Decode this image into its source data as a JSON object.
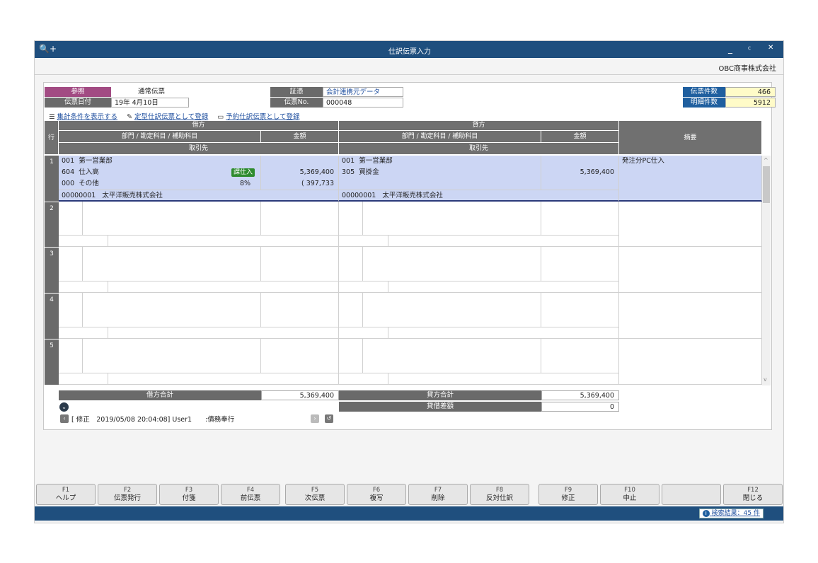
{
  "window": {
    "title": "仕訳伝票入力",
    "minimize": "_",
    "restore": "ꟲ",
    "close": "✕",
    "search_icon": "🔍+"
  },
  "company": "OBC商事株式会社",
  "header": {
    "ref_label": "参照",
    "ref_value": "通常伝票",
    "date_label": "伝票日付",
    "date_value": "19年  4月10日",
    "proof_label": "証憑",
    "proof_value": "会計連携元データ",
    "slip_no_label": "伝票No.",
    "slip_no_value": "000048",
    "count_label": "伝票件数",
    "count_value": "466",
    "detail_label": "明細件数",
    "detail_value": "5912"
  },
  "links": {
    "show_conditions": "集計条件を表示する",
    "register_template": "定型仕訳伝票として登録",
    "register_scheduled": "予約仕訳伝票として登録"
  },
  "grid": {
    "row_header": "行",
    "debit_header": "借方",
    "credit_header": "貸方",
    "dept_header": "部門 / 勘定科目 / 補助科目",
    "amount_header": "金額",
    "partner_header": "取引先",
    "memo_header": "摘要",
    "rows": [
      {
        "num": "1",
        "d_dept_code": "001",
        "d_dept": "第一営業部",
        "d_acct_code": "604",
        "d_acct": "仕入高",
        "d_tax_badge": "課仕入",
        "d_amount": "5,369,400",
        "d_sub_code": "000",
        "d_sub": "その他",
        "d_rate": "8%",
        "d_tax_amount": "( 397,733",
        "d_partner_code": "00000001",
        "d_partner": "太平洋販売株式会社",
        "c_dept_code": "001",
        "c_dept": "第一営業部",
        "c_acct_code": "305",
        "c_acct": "買掛金",
        "c_amount": "5,369,400",
        "c_partner_code": "00000001",
        "c_partner": "太平洋販売株式会社",
        "memo": "発注分PC仕入"
      },
      {
        "num": "2"
      },
      {
        "num": "3"
      },
      {
        "num": "4"
      },
      {
        "num": "5"
      }
    ]
  },
  "totals": {
    "debit_total_label": "借方合計",
    "debit_total": "5,369,400",
    "credit_total_label": "貸方合計",
    "credit_total": "5,369,400",
    "diff_label": "貸借差額",
    "diff": "0"
  },
  "history": {
    "text": "[ 修正　2019/05/08 20:04:08] User1　　:債務奉行"
  },
  "fkeys": [
    {
      "key": "F1",
      "label": "ヘルプ"
    },
    {
      "key": "F2",
      "label": "伝票発行"
    },
    {
      "key": "F3",
      "label": "付箋"
    },
    {
      "key": "F4",
      "label": "前伝票"
    },
    {
      "key": "F5",
      "label": "次伝票"
    },
    {
      "key": "F6",
      "label": "複写"
    },
    {
      "key": "F7",
      "label": "削除"
    },
    {
      "key": "F8",
      "label": "反対仕訳"
    },
    {
      "key": "F9",
      "label": "修正"
    },
    {
      "key": "F10",
      "label": "中止"
    },
    {
      "key": "",
      "label": ""
    },
    {
      "key": "F12",
      "label": "閉じる"
    }
  ],
  "status": {
    "search_result": "検索結果：45 件"
  },
  "colors": {
    "titlebar": "#1f4f7e",
    "ref_label": "#a24b83",
    "label_gray": "#6a6a6a",
    "count_label": "#1f5f9f",
    "count_value": "#fffbc8",
    "selected_row": "#ccd6f4",
    "badge": "#2e8b2e"
  }
}
